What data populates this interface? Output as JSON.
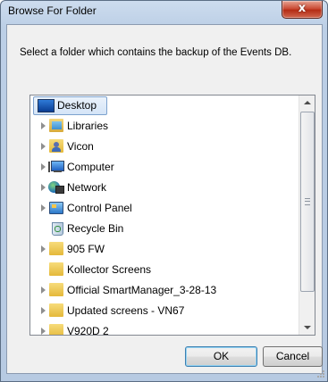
{
  "window": {
    "title": "Browse For Folder",
    "close_glyph": "x",
    "prompt": "Select a folder which contains the backup of the Events DB."
  },
  "tree": {
    "items": [
      {
        "label": "Desktop",
        "icon": "desktop-icon",
        "selected": true
      },
      {
        "label": "Libraries",
        "icon": "libraries-icon",
        "expandable": true
      },
      {
        "label": "Vicon",
        "icon": "user-folder-icon",
        "expandable": true
      },
      {
        "label": "Computer",
        "icon": "computer-icon",
        "expandable": true
      },
      {
        "label": "Network",
        "icon": "network-icon",
        "expandable": true
      },
      {
        "label": "Control Panel",
        "icon": "control-panel-icon",
        "expandable": true
      },
      {
        "label": "Recycle Bin",
        "icon": "recycle-bin-icon",
        "expandable": false
      },
      {
        "label": "905 FW",
        "icon": "folder-icon",
        "expandable": true
      },
      {
        "label": "Kollector Screens",
        "icon": "folder-icon",
        "expandable": false
      },
      {
        "label": "Official SmartManager_3-28-13",
        "icon": "folder-icon",
        "expandable": true
      },
      {
        "label": "Updated screens - VN67",
        "icon": "folder-icon",
        "expandable": true
      },
      {
        "label": "V920D 2",
        "icon": "folder-icon",
        "expandable": true
      }
    ]
  },
  "buttons": {
    "ok": "OK",
    "cancel": "Cancel"
  },
  "colors": {
    "title_bar": "#bccfe6",
    "close_button": "#c7432c",
    "selection": "#d4e4f7",
    "folder": "#e4b83a"
  }
}
